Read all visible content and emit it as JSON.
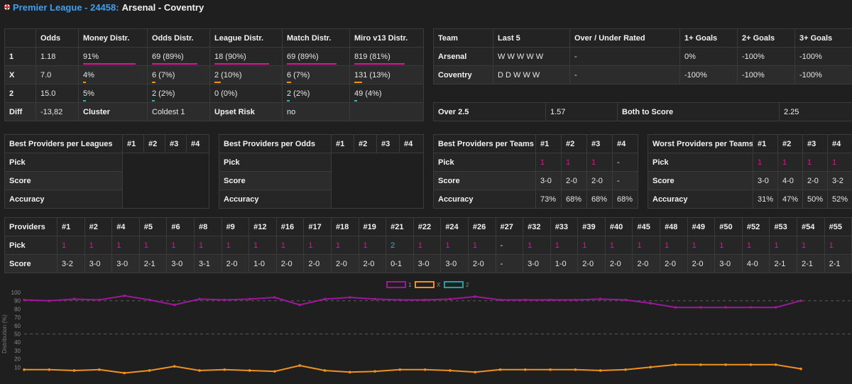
{
  "header": {
    "league": "Premier League - 24458:",
    "match": "Arsenal - Coventry"
  },
  "colors": {
    "pick1": "#a0169e",
    "pickX": "#f0901e",
    "pick2": "#1fa0a8",
    "pink": "#e0119a",
    "orange": "#f0901e",
    "teal": "#29b6c6"
  },
  "odds_table": {
    "headers": [
      "",
      "Odds",
      "Money Distr.",
      "Odds Distr.",
      "League Distr.",
      "Match Distr.",
      "Miro v13 Distr."
    ],
    "rows": [
      {
        "label": "1",
        "cells": [
          "1.18",
          "91%",
          "69 (89%)",
          "18 (90%)",
          "69 (89%)",
          "819 (81%)"
        ],
        "bars": [
          null,
          0.91,
          0.89,
          0.9,
          0.89,
          0.81
        ]
      },
      {
        "label": "X",
        "cells": [
          "7.0",
          "4%",
          "6 (7%)",
          "2 (10%)",
          "6 (7%)",
          "131 (13%)"
        ],
        "bars": [
          null,
          0.04,
          0.07,
          0.1,
          0.07,
          0.13
        ]
      },
      {
        "label": "2",
        "cells": [
          "15.0",
          "5%",
          "2 (2%)",
          "0 (0%)",
          "2 (2%)",
          "49 (4%)"
        ],
        "bars": [
          null,
          0.05,
          0.02,
          0.0,
          0.02,
          0.04
        ]
      }
    ],
    "diff": [
      "Diff",
      "-13,82",
      "Cluster",
      "Coldest 1",
      "Upset Risk",
      "no",
      ""
    ]
  },
  "team_table": {
    "headers": [
      "Team",
      "Last 5",
      "Over / Under Rated",
      "1+ Goals",
      "2+ Goals",
      "3+ Goals"
    ],
    "rows": [
      [
        "Arsenal",
        "W W W W W",
        "-",
        "0%",
        "-100%",
        "-100%"
      ],
      [
        "Coventry",
        "D D W W W",
        "-",
        "-100%",
        "-100%",
        "-100%"
      ]
    ]
  },
  "over_table": [
    "Over 2.5",
    "1.57",
    "Both to Score",
    "2.25"
  ],
  "best_leagues": {
    "title": "Best Providers per Leagues",
    "cols": [
      "#1",
      "#2",
      "#3",
      "#4"
    ],
    "rows": [
      "Pick",
      "Score",
      "Accuracy"
    ]
  },
  "best_odds": {
    "title": "Best Providers per Odds",
    "cols": [
      "#1",
      "#2",
      "#3",
      "#4"
    ],
    "rows": [
      "Pick",
      "Score",
      "Accuracy"
    ]
  },
  "best_teams": {
    "title": "Best Providers per Teams",
    "cols": [
      "#1",
      "#2",
      "#3",
      "#4"
    ],
    "rows": [
      {
        "label": "Pick",
        "values": [
          "1",
          "1",
          "1",
          "-"
        ]
      },
      {
        "label": "Score",
        "values": [
          "3-0",
          "2-0",
          "2-0",
          "-"
        ]
      },
      {
        "label": "Accuracy",
        "values": [
          "73%",
          "68%",
          "68%",
          "68%"
        ]
      }
    ]
  },
  "worst_teams": {
    "title": "Worst Providers per Teams",
    "cols": [
      "#1",
      "#2",
      "#3",
      "#4"
    ],
    "rows": [
      {
        "label": "Pick",
        "values": [
          "1",
          "1",
          "1",
          "1"
        ]
      },
      {
        "label": "Score",
        "values": [
          "3-0",
          "4-0",
          "2-0",
          "3-2"
        ]
      },
      {
        "label": "Accuracy",
        "values": [
          "31%",
          "47%",
          "50%",
          "52%"
        ]
      }
    ]
  },
  "providers": {
    "title": "Providers",
    "cols": [
      "#1",
      "#2",
      "#4",
      "#5",
      "#6",
      "#8",
      "#9",
      "#12",
      "#16",
      "#17",
      "#18",
      "#19",
      "#21",
      "#22",
      "#24",
      "#26",
      "#27",
      "#32",
      "#33",
      "#39",
      "#40",
      "#45",
      "#48",
      "#49",
      "#50",
      "#52",
      "#53",
      "#54",
      "#55"
    ],
    "pick_label": "Pick",
    "score_label": "Score",
    "picks": [
      "1",
      "1",
      "1",
      "1",
      "1",
      "1",
      "1",
      "1",
      "1",
      "1",
      "1",
      "1",
      "2",
      "1",
      "1",
      "1",
      "-",
      "1",
      "1",
      "1",
      "1",
      "1",
      "1",
      "1",
      "1",
      "1",
      "1",
      "1",
      "1"
    ],
    "scores": [
      "3-2",
      "3-0",
      "3-0",
      "2-1",
      "3-0",
      "3-1",
      "2-0",
      "1-0",
      "2-0",
      "2-0",
      "2-0",
      "2-0",
      "0-1",
      "3-0",
      "3-0",
      "2-0",
      "-",
      "3-0",
      "1-0",
      "2-0",
      "2-0",
      "2-0",
      "2-0",
      "2-0",
      "3-0",
      "4-0",
      "2-1",
      "2-1",
      "2-1"
    ]
  },
  "chart_data": {
    "type": "line",
    "ylabel": "Distribution (%)",
    "ylim": [
      0,
      100
    ],
    "yticks": [
      10,
      20,
      30,
      40,
      50,
      60,
      70,
      80,
      90,
      100
    ],
    "x": [
      1,
      2,
      3,
      4,
      5,
      6,
      7,
      8,
      9,
      10,
      11,
      12,
      13,
      14,
      15,
      16,
      17,
      18,
      19,
      20,
      21,
      22,
      23,
      24,
      25,
      26,
      27,
      28,
      29,
      30,
      31,
      32
    ],
    "series": [
      {
        "name": "1",
        "values": [
          91,
          90,
          92,
          91,
          96,
          91,
          85,
          92,
          91,
          92,
          94,
          85,
          92,
          94,
          92,
          91,
          91,
          92,
          95,
          91,
          91,
          91,
          91,
          92,
          91,
          87,
          82,
          82,
          82,
          82,
          82,
          90
        ]
      },
      {
        "name": "X",
        "values": [
          7,
          7,
          6,
          7,
          3,
          6,
          11,
          6,
          7,
          6,
          5,
          12,
          6,
          4,
          5,
          7,
          7,
          6,
          4,
          7,
          7,
          7,
          7,
          6,
          7,
          10,
          13,
          13,
          13,
          13,
          13,
          8
        ]
      },
      {
        "name": "2",
        "values": [
          2,
          3,
          2,
          2,
          1,
          3,
          4,
          2,
          2,
          2,
          1,
          3,
          2,
          2,
          3,
          2,
          2,
          2,
          1,
          2,
          2,
          2,
          2,
          2,
          2,
          3,
          5,
          5,
          5,
          5,
          5,
          2
        ]
      }
    ],
    "legend_placement": "top-center",
    "grid": false
  }
}
